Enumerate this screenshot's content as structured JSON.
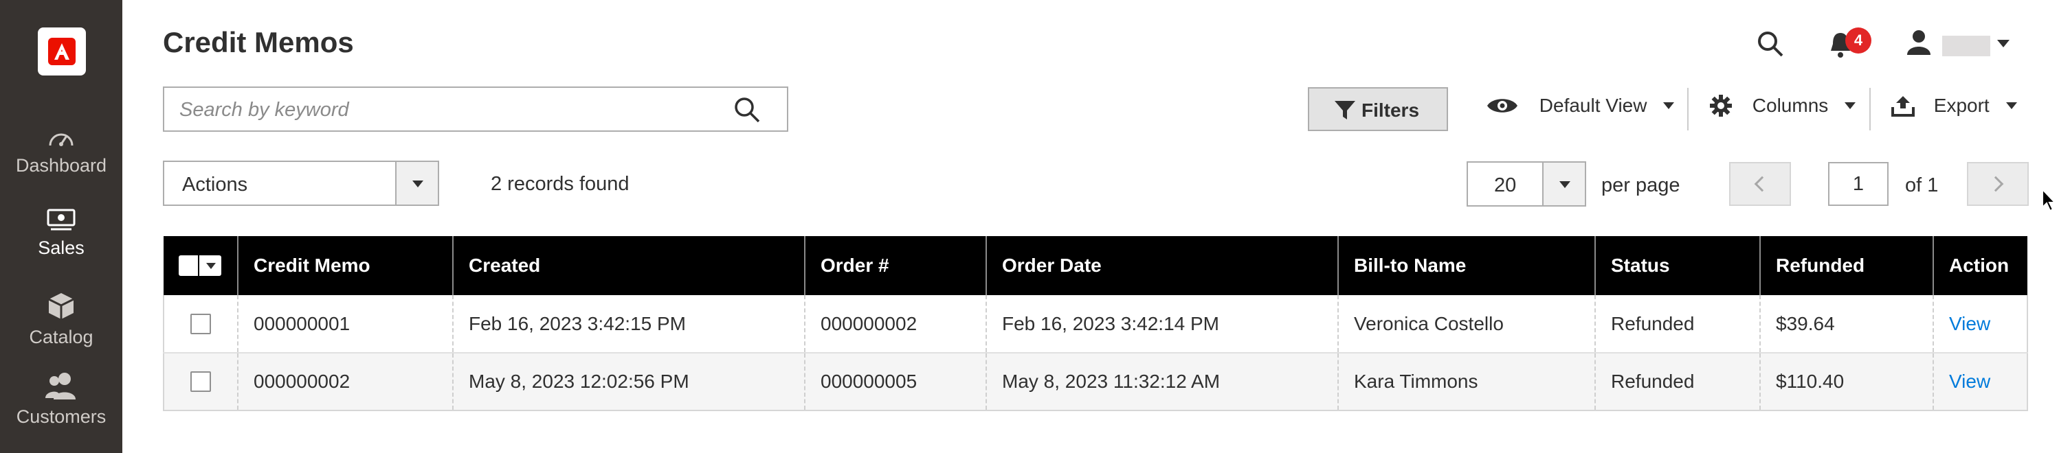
{
  "sidebar": {
    "logo": "adobe-logo",
    "items": [
      {
        "label": "Dashboard",
        "icon": "speedometer-icon"
      },
      {
        "label": "Sales",
        "icon": "money-icon"
      },
      {
        "label": "Catalog",
        "icon": "cube-icon"
      },
      {
        "label": "Customers",
        "icon": "users-icon"
      }
    ]
  },
  "header": {
    "title": "Credit Memos",
    "notifications_count": "4"
  },
  "search": {
    "placeholder": "Search by keyword",
    "value": ""
  },
  "toolbar": {
    "filters_label": "Filters",
    "view_label": "Default View",
    "columns_label": "Columns",
    "export_label": "Export"
  },
  "actions": {
    "label": "Actions",
    "records_found": "2 records found"
  },
  "pagination": {
    "per_page": "20",
    "per_page_label": "per page",
    "current_page": "1",
    "of_label": "of 1"
  },
  "table": {
    "columns": [
      "Credit Memo",
      "Created",
      "Order #",
      "Order Date",
      "Bill-to Name",
      "Status",
      "Refunded",
      "Action"
    ],
    "rows": [
      {
        "credit_memo": "000000001",
        "created": "Feb 16, 2023 3:42:15 PM",
        "order": "000000002",
        "order_date": "Feb 16, 2023 3:42:14 PM",
        "bill_to": "Veronica Costello",
        "status": "Refunded",
        "refunded": "$39.64",
        "action": "View"
      },
      {
        "credit_memo": "000000002",
        "created": "May 8, 2023 12:02:56 PM",
        "order": "000000005",
        "order_date": "May 8, 2023 11:32:12 AM",
        "bill_to": "Kara Timmons",
        "status": "Refunded",
        "refunded": "$110.40",
        "action": "View"
      }
    ]
  },
  "colors": {
    "sidebar_bg": "#373330",
    "table_header_bg": "#000000",
    "link": "#007bdb",
    "badge": "#e22626"
  }
}
